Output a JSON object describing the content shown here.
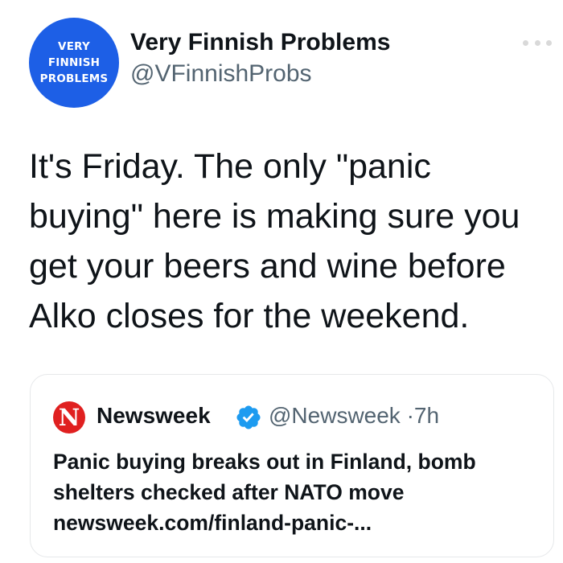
{
  "tweet": {
    "avatar": {
      "lines": [
        "VERY",
        "FINNISH",
        "PROBLEMS"
      ],
      "bg_color": "#1d5fe6"
    },
    "display_name": "Very Finnish Problems",
    "handle": "@VFinnishProbs",
    "more_icon": "more-horizontal-icon",
    "text": "It's Friday. The only \"panic buying\" here is making sure you get your beers and wine before Alko closes for the weekend."
  },
  "quoted_tweet": {
    "logo_letter": "N",
    "logo_color": "#e02020",
    "name": "Newsweek",
    "verified_icon": "verified-badge-icon",
    "verified_color": "#1d9bf0",
    "handle": "@Newsweek",
    "separator": "·",
    "time": "7h",
    "text": "Panic buying breaks out in Finland, bomb shelters checked after NATO move newsweek.com/finland-panic-..."
  }
}
